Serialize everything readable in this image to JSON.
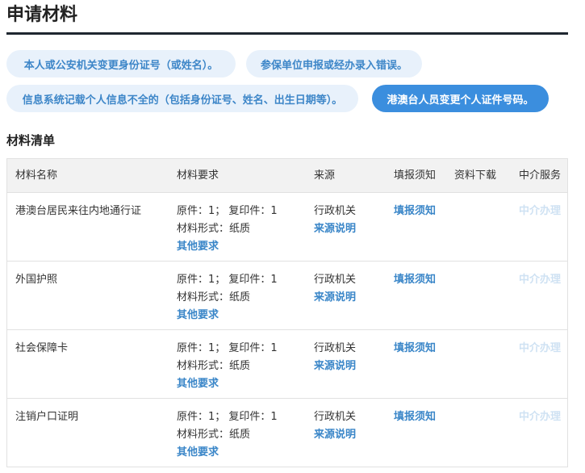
{
  "page": {
    "title": "申请材料"
  },
  "scenarios": [
    {
      "label": "本人或公安机关变更身份证号（或姓名）。",
      "active": false
    },
    {
      "label": "参保单位申报或经办录入错误。",
      "active": false
    },
    {
      "label": "信息系统记载个人信息不全的（包括身份证号、姓名、出生日期等）。",
      "active": false
    },
    {
      "label": "港澳台人员变更个人证件号码。",
      "active": true
    }
  ],
  "materials": {
    "section_title": "材料清单",
    "columns": [
      "材料名称",
      "材料要求",
      "来源",
      "填报须知",
      "资料下载",
      "中介服务"
    ],
    "rows": [
      {
        "name": "港澳台居民来往内地通行证",
        "req_count": "原件：1； 复印件：1",
        "req_form": "材料形式：纸质",
        "req_more": "其他要求",
        "source": "行政机关",
        "source_note": "来源说明",
        "fill": "填报须知",
        "agent": "中介办理"
      },
      {
        "name": "外国护照",
        "req_count": "原件：1； 复印件：1",
        "req_form": "材料形式：纸质",
        "req_more": "其他要求",
        "source": "行政机关",
        "source_note": "来源说明",
        "fill": "填报须知",
        "agent": "中介办理"
      },
      {
        "name": "社会保障卡",
        "req_count": "原件：1； 复印件：1",
        "req_form": "材料形式：纸质",
        "req_more": "其他要求",
        "source": "行政机关",
        "source_note": "来源说明",
        "fill": "填报须知",
        "agent": "中介办理"
      },
      {
        "name": "注销户口证明",
        "req_count": "原件：1； 复印件：1",
        "req_form": "材料形式：纸质",
        "req_more": "其他要求",
        "source": "行政机关",
        "source_note": "来源说明",
        "fill": "填报须知",
        "agent": "中介办理"
      }
    ]
  }
}
